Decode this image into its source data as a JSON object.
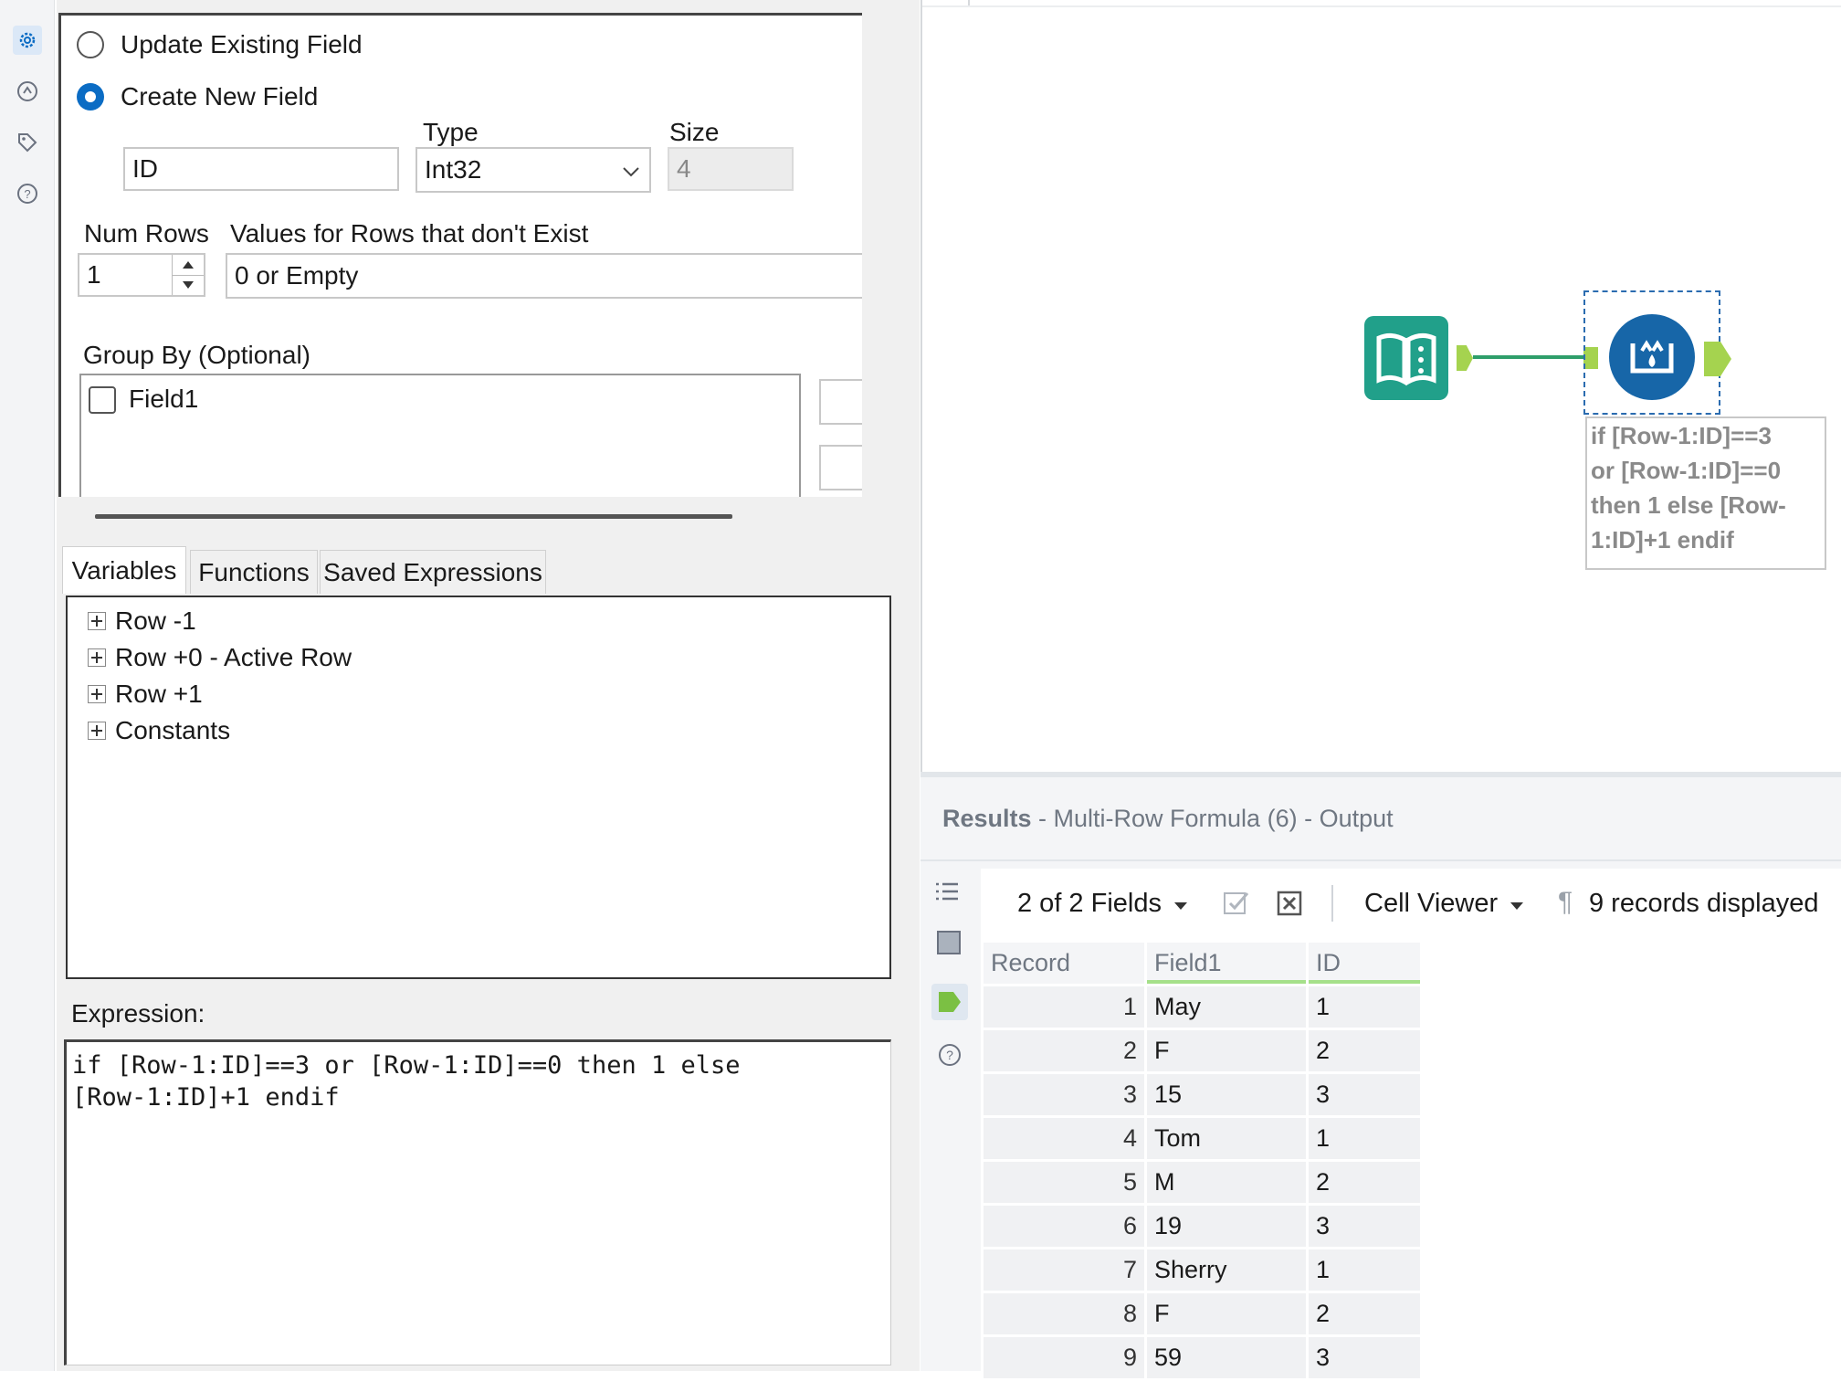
{
  "config": {
    "update_existing_label": "Update Existing Field",
    "create_new_label": "Create New  Field",
    "type_label": "Type",
    "size_label": "Size",
    "field_name_value": "ID",
    "type_value": "Int32",
    "size_value": "4",
    "num_rows_label": "Num Rows",
    "values_label": "Values for Rows that don't Exist",
    "num_rows_value": "1",
    "values_value": "0 or Empty",
    "group_by_label": "Group By (Optional)",
    "group_by_fields": [
      "Field1"
    ],
    "tabs": [
      "Variables",
      "Functions",
      "Saved Expressions"
    ],
    "tree": [
      "Row -1",
      "Row +0 - Active Row",
      "Row +1",
      "Constants"
    ],
    "expression_label": "Expression:",
    "expression_line1": "if [Row-1:ID]==3 or [Row-1:ID]==0 then 1 else",
    "expression_line2": "[Row-1:ID]+1 endif"
  },
  "canvas": {
    "annotation_lines": [
      "if [Row-1:ID]==3",
      "or [Row-1:ID]==0",
      "then 1 else [Row-",
      "1:ID]+1 endif"
    ]
  },
  "results": {
    "title": "Results",
    "subtitle": " - Multi-Row Formula (6) - Output",
    "fields_label": "2 of 2 Fields",
    "cell_viewer_label": "Cell Viewer",
    "records_label": "9 records displayed",
    "columns": [
      "Record",
      "Field1",
      "ID"
    ],
    "rows": [
      [
        "1",
        "May",
        "1"
      ],
      [
        "2",
        "F",
        "2"
      ],
      [
        "3",
        "15",
        "3"
      ],
      [
        "4",
        "Tom",
        "1"
      ],
      [
        "5",
        "M",
        "2"
      ],
      [
        "6",
        "19",
        "3"
      ],
      [
        "7",
        "Sherry",
        "1"
      ],
      [
        "8",
        "F",
        "2"
      ],
      [
        "9",
        "59",
        "3"
      ]
    ]
  },
  "colors": {
    "accent_blue": "#0b6cc4",
    "input_tool_green": "#21a08a",
    "formula_tool_blue": "#1766a8",
    "connector_green": "#a5d34f"
  }
}
